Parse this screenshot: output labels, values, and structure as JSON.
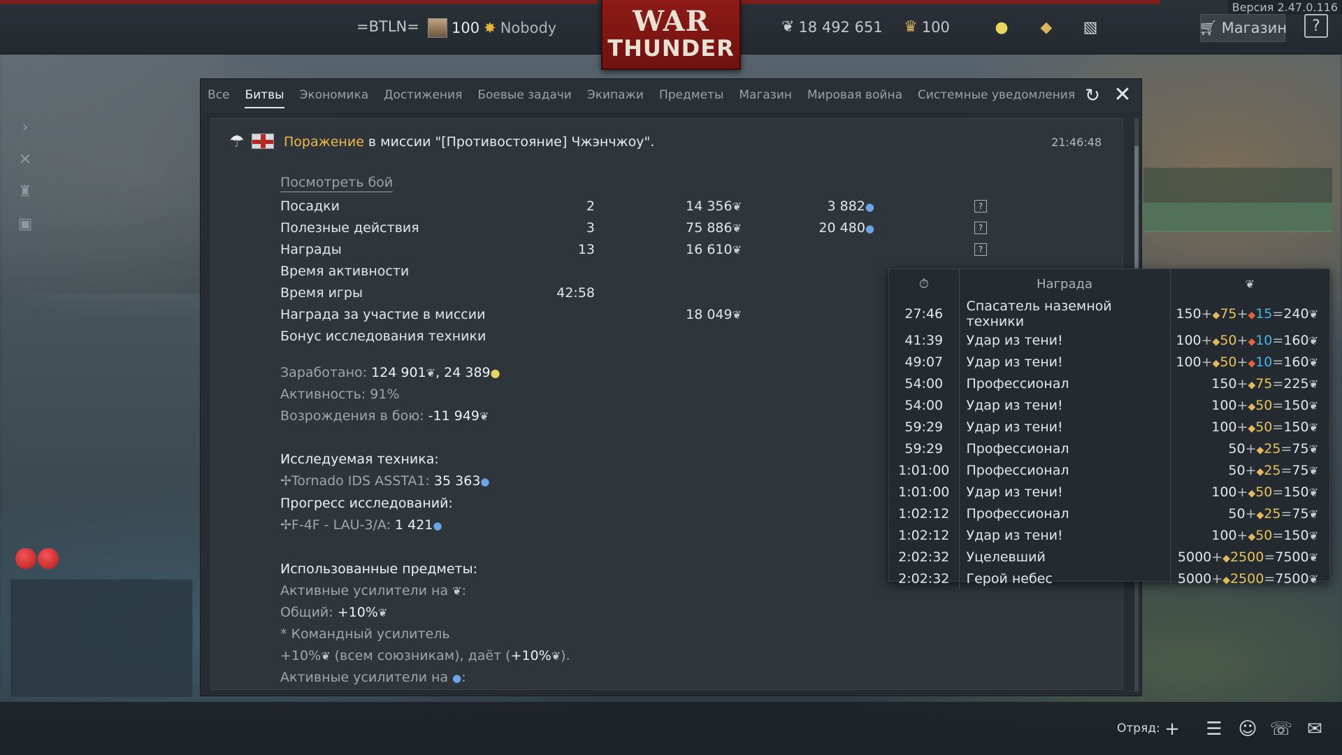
{
  "topbar": {
    "version": "Версия 2.47.0.116",
    "clan_tag": "=BTLN=",
    "level": "100",
    "nickname": "Nobody",
    "silver_lions": "18 492 651",
    "golden_eagles": "100",
    "shop_label": "Магазин",
    "help_label": "?",
    "logo_top": "WAR",
    "logo_bottom": "THUNDER"
  },
  "tabs": [
    {
      "label": "Все"
    },
    {
      "label": "Битвы"
    },
    {
      "label": "Экономика"
    },
    {
      "label": "Достижения"
    },
    {
      "label": "Боевые задачи"
    },
    {
      "label": "Экипажи"
    },
    {
      "label": "Предметы"
    },
    {
      "label": "Магазин"
    },
    {
      "label": "Мировая война"
    },
    {
      "label": "Системные уведомления"
    }
  ],
  "message": {
    "result": "Поражение",
    "title_rest": " в миссии \"[Противостояние] Чжэнчжоу\".",
    "time": "21:46:48",
    "view_battle": "Посмотреть бой"
  },
  "stats": [
    {
      "label": "Посадки",
      "count": "2",
      "sl": "14 356",
      "rp": "3 882",
      "help": "?"
    },
    {
      "label": "Полезные действия",
      "count": "3",
      "sl": "75 886",
      "rp": "20 480",
      "help": "?"
    },
    {
      "label": "Награды",
      "count": "13",
      "sl": "16 610",
      "rp": "",
      "help": "?"
    },
    {
      "label": "Время активности",
      "count": "",
      "sl": "",
      "rp": "",
      "help": ""
    },
    {
      "label": "Время игры",
      "count": "42:58",
      "sl": "",
      "rp": "",
      "help": ""
    },
    {
      "label": "Награда за участие в миссии",
      "count": "",
      "sl": "18 049",
      "rp": "",
      "help": ""
    },
    {
      "label": "Бонус исследования техники",
      "count": "",
      "sl": "",
      "rp": "",
      "help": ""
    }
  ],
  "summary": {
    "earned_label": "Заработано: ",
    "earned_sl": "124 901",
    "earned_rp": "24 389",
    "activity_label": "Активность: ",
    "activity_value": "91%",
    "respawn_label": "Возрождения в бою: ",
    "respawn_value": "-11 949",
    "researched_title": "Исследуемая техника:",
    "researched_vehicle": "Tornado IDS ASSTA1: ",
    "researched_value": "35 363",
    "progress_title": "Прогресс исследований:",
    "progress_vehicle": "F-4F - LAU-3/A: ",
    "progress_value": "1 421",
    "used_items_title": "Использованные предметы:",
    "boosters_sl": "Активные усилители на ",
    "general_label": "Общий: ",
    "general_value": "+10%",
    "commander_booster": "* Командный усилитель",
    "commander_desc_a": "+10%",
    "commander_desc_b": " (всем союзникам), даёт (",
    "commander_desc_c": "+10%",
    "commander_desc_d": ").",
    "boosters_rp": "Активные усилители на "
  },
  "awards": {
    "header_award": "Награда",
    "rows": [
      {
        "time": "27:46",
        "name": "Спасатель наземной техники",
        "base": "150",
        "b1": "75",
        "b2": "15",
        "total": "240"
      },
      {
        "time": "41:39",
        "name": "Удар из тени!",
        "base": "100",
        "b1": "50",
        "b2": "10",
        "total": "160"
      },
      {
        "time": "49:07",
        "name": "Удар из тени!",
        "base": "100",
        "b1": "50",
        "b2": "10",
        "total": "160"
      },
      {
        "time": "54:00",
        "name": "Профессионал",
        "base": "150",
        "b1": "75",
        "b2": "",
        "total": "225"
      },
      {
        "time": "54:00",
        "name": "Удар из тени!",
        "base": "100",
        "b1": "50",
        "b2": "",
        "total": "150"
      },
      {
        "time": "59:29",
        "name": "Удар из тени!",
        "base": "100",
        "b1": "50",
        "b2": "",
        "total": "150"
      },
      {
        "time": "59:29",
        "name": "Профессионал",
        "base": "50",
        "b1": "25",
        "b2": "",
        "total": "75"
      },
      {
        "time": "1:01:00",
        "name": "Профессионал",
        "base": "50",
        "b1": "25",
        "b2": "",
        "total": "75"
      },
      {
        "time": "1:01:00",
        "name": "Удар из тени!",
        "base": "100",
        "b1": "50",
        "b2": "",
        "total": "150"
      },
      {
        "time": "1:02:12",
        "name": "Профессионал",
        "base": "50",
        "b1": "25",
        "b2": "",
        "total": "75"
      },
      {
        "time": "1:02:12",
        "name": "Удар из тени!",
        "base": "100",
        "b1": "50",
        "b2": "",
        "total": "150"
      },
      {
        "time": "2:02:32",
        "name": "Уцелевший",
        "base": "5000",
        "b1": "2500",
        "b2": "",
        "total": "7500"
      },
      {
        "time": "2:02:32",
        "name": "Герой небес",
        "base": "5000",
        "b1": "2500",
        "b2": "",
        "total": "7500"
      }
    ]
  },
  "bottombar": {
    "squad_label": "Отряд:"
  },
  "colors": {
    "loss": "#f0b84a",
    "rp_blue": "#6aa5e6",
    "gold_bonus": "#e8c45a",
    "blue_bonus": "#45b8e8",
    "brand_red": "#8d1a17"
  }
}
